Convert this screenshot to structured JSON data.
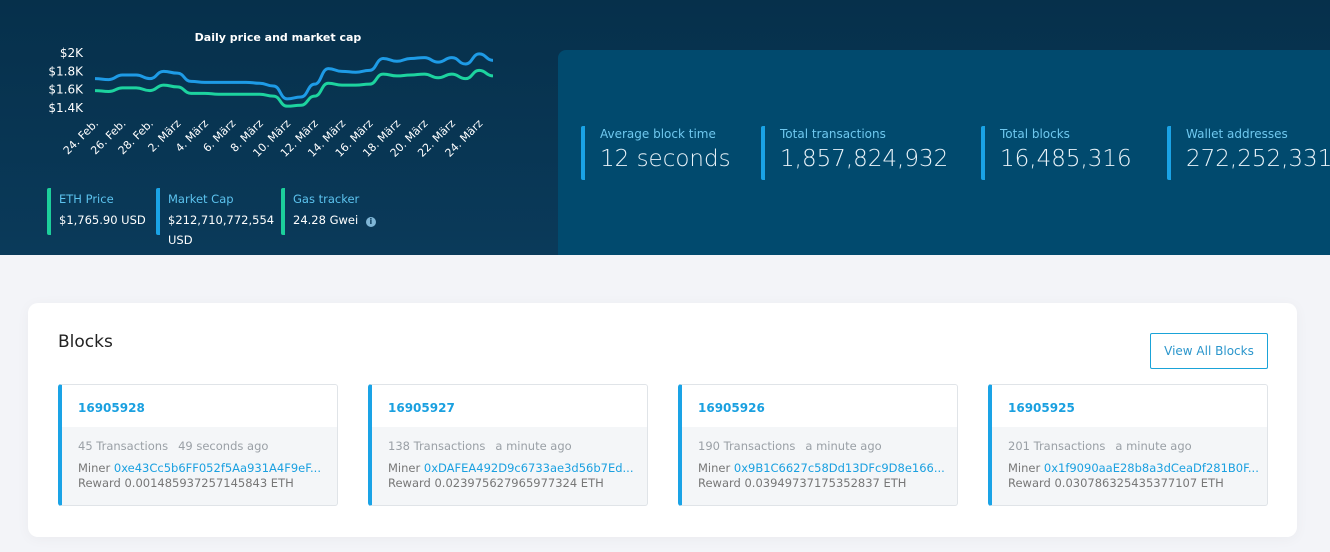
{
  "chart_data": {
    "type": "line",
    "title": "Daily price and market cap",
    "x": [
      "24. Feb.",
      "25. Feb.",
      "26. Feb.",
      "27. Feb.",
      "28. Feb.",
      "1. März",
      "2. März",
      "3. März",
      "4. März",
      "5. März",
      "6. März",
      "7. März",
      "8. März",
      "9. März",
      "10. März",
      "11. März",
      "12. März",
      "13. März",
      "14. März",
      "15. März",
      "16. März",
      "17. März",
      "18. März",
      "19. März",
      "20. März",
      "21. März",
      "22. März",
      "23. März",
      "24. März",
      "25. März"
    ],
    "xticks": [
      "24. Feb.",
      "26. Feb.",
      "28. Feb.",
      "2. März",
      "4. März",
      "6. März",
      "8. März",
      "10. März",
      "12. März",
      "14. März",
      "16. März",
      "18. März",
      "20. März",
      "22. März",
      "24. März"
    ],
    "yticks": [
      "$1.4K",
      "$1.6K",
      "$1.8K",
      "$2K"
    ],
    "ytick_values": [
      1400,
      1600,
      1800,
      2000
    ],
    "ylim": [
      1350,
      2050
    ],
    "grid": false,
    "series": [
      {
        "color": "#1e9be6",
        "values": [
          1720,
          1710,
          1760,
          1760,
          1720,
          1800,
          1780,
          1690,
          1680,
          1680,
          1680,
          1680,
          1670,
          1640,
          1500,
          1520,
          1660,
          1830,
          1800,
          1790,
          1810,
          1940,
          1910,
          1940,
          1950,
          1900,
          1950,
          1880,
          1990,
          1920
        ]
      },
      {
        "color": "#1dd39f",
        "values": [
          1590,
          1580,
          1620,
          1620,
          1590,
          1650,
          1630,
          1560,
          1560,
          1550,
          1550,
          1550,
          1550,
          1530,
          1420,
          1430,
          1530,
          1670,
          1650,
          1650,
          1660,
          1770,
          1750,
          1760,
          1770,
          1730,
          1770,
          1720,
          1810,
          1750
        ]
      }
    ]
  },
  "kpis": [
    {
      "label": "ETH Price",
      "value": "$1,765.90 USD",
      "color": "#1ccf9b"
    },
    {
      "label": "Market Cap",
      "value": "$212,710,772,554 USD",
      "color": "#1aa3e6"
    },
    {
      "label": "Gas tracker",
      "value": "24.28 Gwei",
      "color": "#1ccf9b",
      "icon": "info-icon"
    }
  ],
  "stats": [
    {
      "label": "Average block time",
      "value": "12 seconds"
    },
    {
      "label": "Total transactions",
      "value": "1,857,824,932"
    },
    {
      "label": "Total blocks",
      "value": "16,485,316"
    },
    {
      "label": "Wallet addresses",
      "value": "272,252,331"
    }
  ],
  "blocks_section": {
    "title": "Blocks",
    "view_all": "View All Blocks",
    "miner_label": "Miner",
    "reward_label": "Reward",
    "items": [
      {
        "number": "16905928",
        "transactions": "45 Transactions",
        "age": "49 seconds ago",
        "miner": "0xe43Cc5b6FF052f5Aa931A4F9eF...",
        "reward": "0.001485937257145843 ETH"
      },
      {
        "number": "16905927",
        "transactions": "138 Transactions",
        "age": "a minute ago",
        "miner": "0xDAFEA492D9c6733ae3d56b7Ed...",
        "reward": "0.023975627965977324 ETH"
      },
      {
        "number": "16905926",
        "transactions": "190 Transactions",
        "age": "a minute ago",
        "miner": "0x9B1C6627c58Dd13DFc9D8e166...",
        "reward": "0.03949737175352837 ETH"
      },
      {
        "number": "16905925",
        "transactions": "201 Transactions",
        "age": "a minute ago",
        "miner": "0x1f9090aaE28b8a3dCeaDf281B0F...",
        "reward": "0.030786325435377107 ETH"
      }
    ]
  }
}
